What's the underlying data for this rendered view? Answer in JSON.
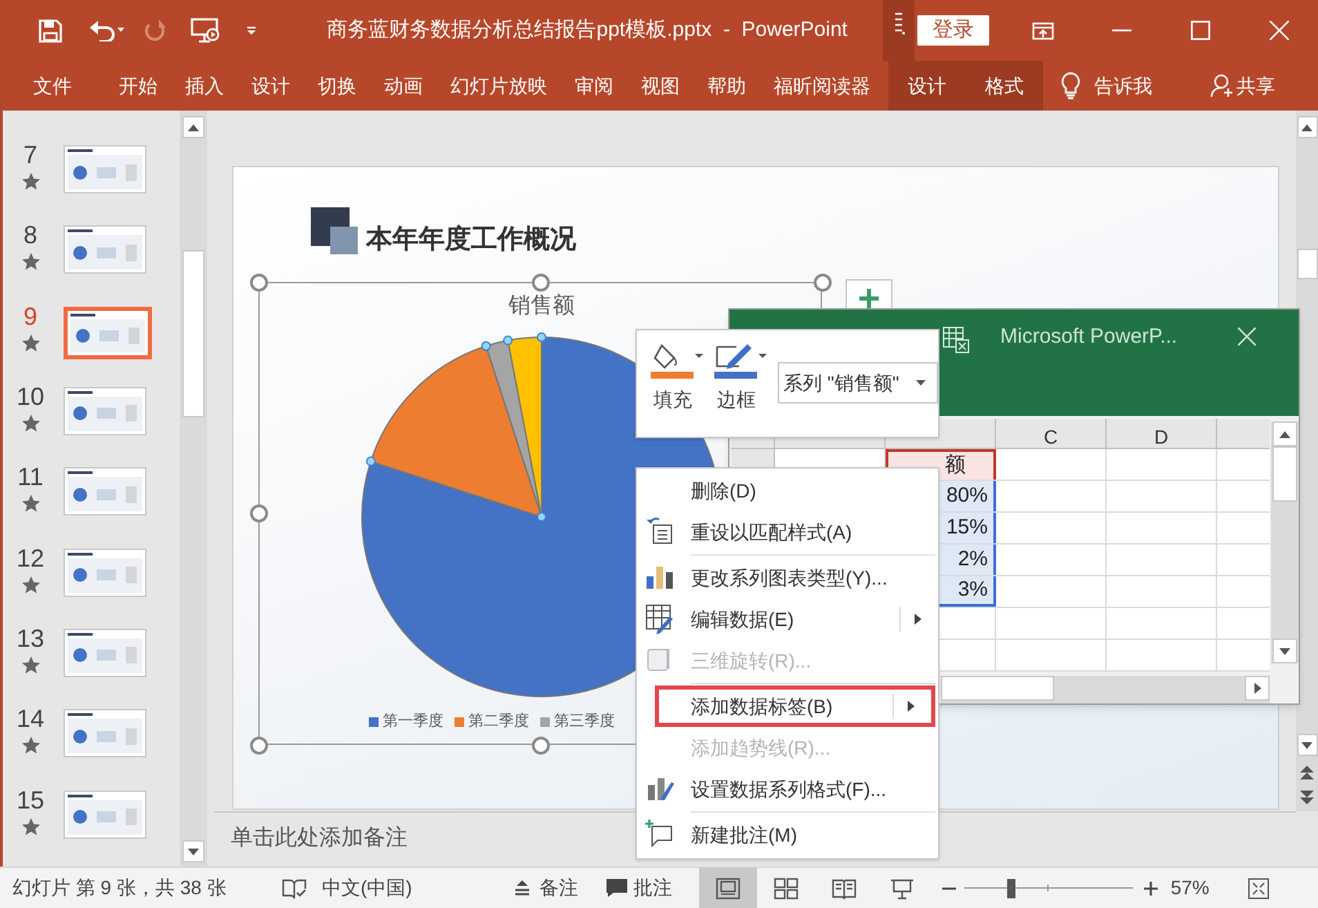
{
  "title_bar": {
    "title": "商务蓝财务数据分析总结报告ppt模板.pptx  -  PowerPoint",
    "sign_in": "登录"
  },
  "ribbon_tabs": [
    {
      "label": "文件",
      "contextual": false
    },
    {
      "label": "开始",
      "contextual": false
    },
    {
      "label": "插入",
      "contextual": false
    },
    {
      "label": "设计",
      "contextual": false
    },
    {
      "label": "切换",
      "contextual": false
    },
    {
      "label": "动画",
      "contextual": false
    },
    {
      "label": "幻灯片放映",
      "contextual": false
    },
    {
      "label": "审阅",
      "contextual": false
    },
    {
      "label": "视图",
      "contextual": false
    },
    {
      "label": "帮助",
      "contextual": false
    },
    {
      "label": "福昕阅读器",
      "contextual": false
    },
    {
      "label": "设计",
      "contextual": true
    },
    {
      "label": "格式",
      "contextual": true
    }
  ],
  "tell_me": "告诉我",
  "share": "共享",
  "slides": [
    {
      "number": "7",
      "selected": false
    },
    {
      "number": "8",
      "selected": false
    },
    {
      "number": "9",
      "selected": true
    },
    {
      "number": "10",
      "selected": false
    },
    {
      "number": "11",
      "selected": false
    },
    {
      "number": "12",
      "selected": false
    },
    {
      "number": "13",
      "selected": false
    },
    {
      "number": "14",
      "selected": false
    },
    {
      "number": "15",
      "selected": false
    }
  ],
  "slide": {
    "title": "本年年度工作概况",
    "chart": {
      "title": "销售额",
      "legend": [
        {
          "label": "第一季度",
          "color": "#4472c4"
        },
        {
          "label": "第二季度",
          "color": "#ed7d31"
        },
        {
          "label": "第三季度",
          "color": "#a5a5a5"
        }
      ]
    }
  },
  "mini_toolbar": {
    "fill_label": "填充",
    "border_label": "边框",
    "series_select": "系列 \"销售额\""
  },
  "excel": {
    "title": "Microsoft PowerP...",
    "columns": [
      "C",
      "D"
    ],
    "column_b_cells": [
      "额",
      "80%",
      "15%",
      "2%",
      "3%"
    ]
  },
  "context_menu": [
    {
      "label": "删除(D)",
      "kind": "plain",
      "disabled": false,
      "submenu": false,
      "highlighted": false,
      "separator_after": false
    },
    {
      "label": "重设以匹配样式(A)",
      "kind": "reset",
      "disabled": false,
      "submenu": false,
      "highlighted": false,
      "separator_after": true
    },
    {
      "label": "更改系列图表类型(Y)...",
      "kind": "chart",
      "disabled": false,
      "submenu": false,
      "highlighted": false,
      "separator_after": false
    },
    {
      "label": "编辑数据(E)",
      "kind": "edit",
      "disabled": false,
      "submenu": true,
      "highlighted": false,
      "separator_after": false
    },
    {
      "label": "三维旋转(R)...",
      "kind": "rotate",
      "disabled": true,
      "submenu": false,
      "highlighted": false,
      "separator_after": true
    },
    {
      "label": "添加数据标签(B)",
      "kind": "plain",
      "disabled": false,
      "submenu": true,
      "highlighted": true,
      "separator_after": false
    },
    {
      "label": "添加趋势线(R)...",
      "kind": "plain",
      "disabled": true,
      "submenu": false,
      "highlighted": false,
      "separator_after": false
    },
    {
      "label": "设置数据系列格式(F)...",
      "kind": "format",
      "disabled": false,
      "submenu": false,
      "highlighted": false,
      "separator_after": true
    },
    {
      "label": "新建批注(M)",
      "kind": "comment",
      "disabled": false,
      "submenu": false,
      "highlighted": false,
      "separator_after": false
    }
  ],
  "notes_placeholder": "单击此处添加备注",
  "status_bar": {
    "slide_info": "幻灯片 第 9 张，共 38 张",
    "language": "中文(中国)",
    "notes": "备注",
    "comments": "批注",
    "views": [
      {
        "kind": "normal",
        "selected": true
      },
      {
        "kind": "sorter",
        "selected": false
      },
      {
        "kind": "reading",
        "selected": false
      },
      {
        "kind": "slideshow",
        "selected": false
      }
    ],
    "zoom": {
      "level": 0.28
    },
    "zoom_text": "57%"
  }
}
